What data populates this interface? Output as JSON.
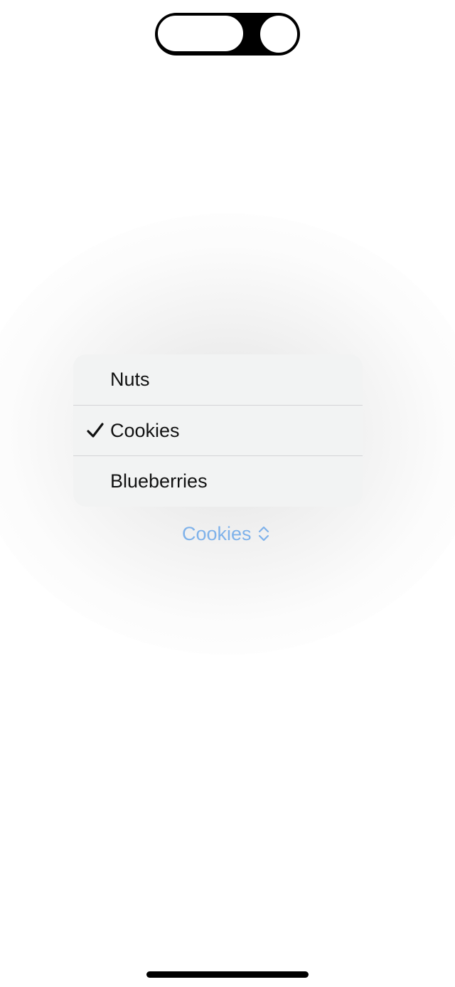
{
  "menu": {
    "items": [
      {
        "label": "Nuts",
        "selected": false
      },
      {
        "label": "Cookies",
        "selected": true
      },
      {
        "label": "Blueberries",
        "selected": false
      }
    ],
    "check_icon": "checkmark-icon"
  },
  "picker": {
    "selected_label": "Cookies",
    "icon": "chevron-up-down-icon",
    "color": "#7fb2ea"
  }
}
